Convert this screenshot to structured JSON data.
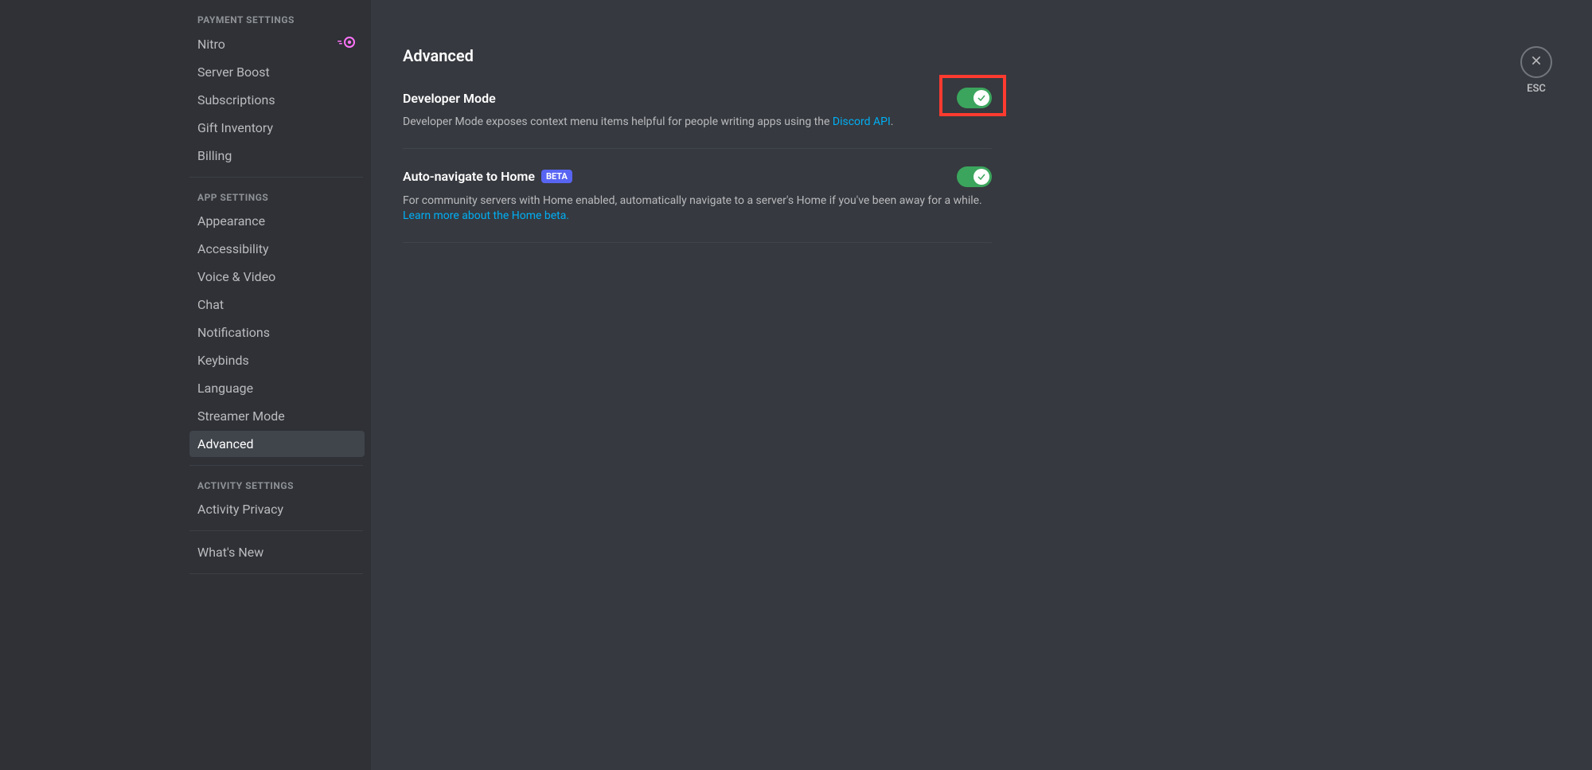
{
  "sidebar": {
    "sections": [
      {
        "header": "PAYMENT SETTINGS",
        "items": [
          {
            "label": "Nitro",
            "hasNitroBadge": true
          },
          {
            "label": "Server Boost"
          },
          {
            "label": "Subscriptions"
          },
          {
            "label": "Gift Inventory"
          },
          {
            "label": "Billing"
          }
        ]
      },
      {
        "header": "APP SETTINGS",
        "items": [
          {
            "label": "Appearance"
          },
          {
            "label": "Accessibility"
          },
          {
            "label": "Voice & Video"
          },
          {
            "label": "Chat"
          },
          {
            "label": "Notifications"
          },
          {
            "label": "Keybinds"
          },
          {
            "label": "Language"
          },
          {
            "label": "Streamer Mode"
          },
          {
            "label": "Advanced",
            "active": true
          }
        ]
      },
      {
        "header": "ACTIVITY SETTINGS",
        "items": [
          {
            "label": "Activity Privacy"
          }
        ]
      },
      {
        "items": [
          {
            "label": "What's New"
          }
        ]
      }
    ]
  },
  "page": {
    "title": "Advanced",
    "close_hint": "ESC"
  },
  "settings": {
    "developer_mode": {
      "title": "Developer Mode",
      "desc_pre": "Developer Mode exposes context menu items helpful for people writing apps using the ",
      "desc_link": "Discord API",
      "desc_post": ".",
      "enabled": true,
      "highlighted": true
    },
    "auto_home": {
      "title": "Auto-navigate to Home",
      "badge": "BETA",
      "desc_pre": "For community servers with Home enabled, automatically navigate to a server's Home if you've been away for a while. ",
      "desc_link": "Learn more about the Home beta.",
      "enabled": true
    }
  }
}
